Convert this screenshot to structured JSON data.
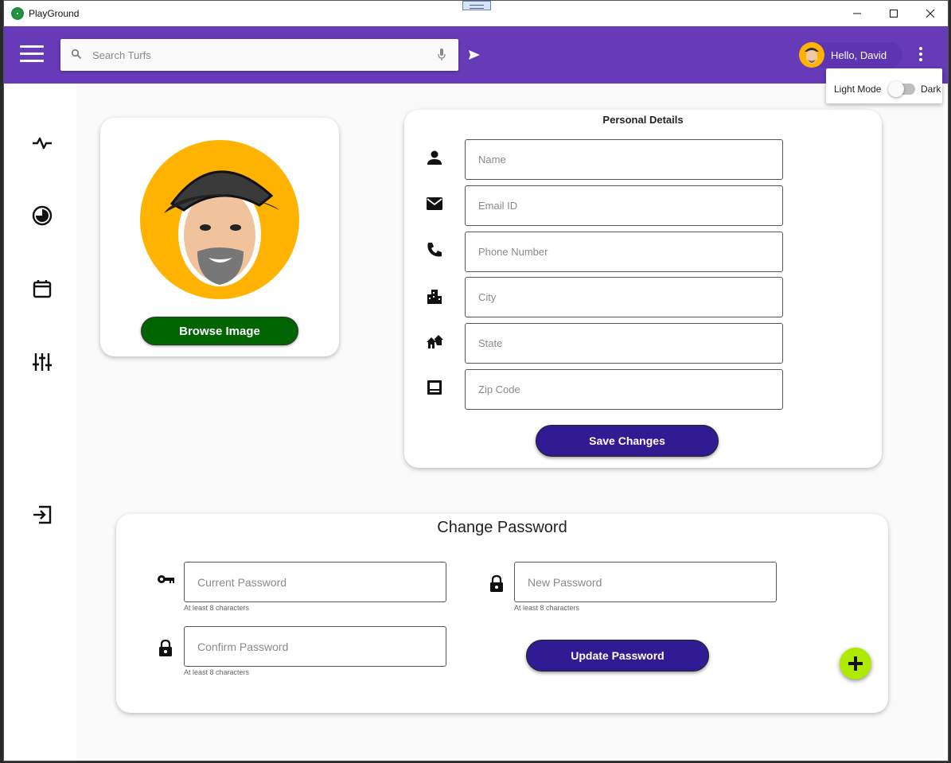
{
  "window": {
    "title": "PlayGround"
  },
  "appbar": {
    "search_placeholder": "Search Turfs",
    "greeting": "Hello, David"
  },
  "theme_popup": {
    "light_label": "Light Mode",
    "dark_label": "Dark",
    "toggle_on": false
  },
  "sidebar": {
    "items": [
      {
        "icon": "activity-icon"
      },
      {
        "icon": "pie-chart-icon"
      },
      {
        "icon": "calendar-icon"
      },
      {
        "icon": "tune-icon"
      },
      {
        "icon": "logout-icon"
      }
    ]
  },
  "profile": {
    "browse_label": "Browse Image"
  },
  "personal_details": {
    "title": "Personal Details",
    "fields": [
      {
        "icon": "person-icon",
        "placeholder": "Name"
      },
      {
        "icon": "email-icon",
        "placeholder": "Email ID"
      },
      {
        "icon": "phone-icon",
        "placeholder": "Phone Number"
      },
      {
        "icon": "city-icon",
        "placeholder": "City"
      },
      {
        "icon": "state-icon",
        "placeholder": "State"
      },
      {
        "icon": "zip-icon",
        "placeholder": "Zip Code"
      }
    ],
    "save_label": "Save Changes"
  },
  "change_password": {
    "title": "Change Password",
    "current": {
      "icon": "key-icon",
      "placeholder": "Current Password",
      "hint": "At least 8 characters"
    },
    "new": {
      "icon": "lock-icon",
      "placeholder": "New Password",
      "hint": "At least 8 characters"
    },
    "confirm": {
      "icon": "lock-icon",
      "placeholder": "Confirm Password",
      "hint": "At least 8 characters"
    },
    "update_label": "Update Password"
  },
  "colors": {
    "primary": "#673ab7",
    "button": "#311b92",
    "browse": "#006400",
    "fab": "#aeea00",
    "avatar_bg": "#ffb300"
  }
}
